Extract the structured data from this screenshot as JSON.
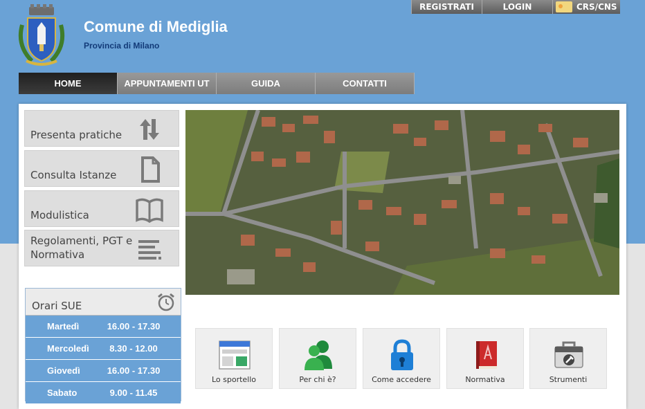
{
  "userbar": {
    "register": "REGISTRATI",
    "login": "LOGIN",
    "crs": "CRS/CNS"
  },
  "header": {
    "title": "Comune di Mediglia",
    "subtitle": "Provincia di Milano"
  },
  "nav": [
    {
      "label": "HOME",
      "active": true
    },
    {
      "label": "APPUNTAMENTI UT",
      "active": false
    },
    {
      "label": "GUIDA",
      "active": false
    },
    {
      "label": "CONTATTI",
      "active": false
    }
  ],
  "sidebar": [
    {
      "label": "Presenta pratiche",
      "icon": "sort-arrows-icon"
    },
    {
      "label": "Consulta Istanze",
      "icon": "document-icon"
    },
    {
      "label": "Modulistica",
      "icon": "open-book-icon"
    },
    {
      "label": "Regolamenti, PGT e Normativa",
      "icon": "text-lines-icon"
    }
  ],
  "hours": {
    "title": "Orari SUE",
    "rows": [
      {
        "day": "Martedì",
        "time": "16.00 - 17.30"
      },
      {
        "day": "Mercoledì",
        "time": "8.30 - 12.00"
      },
      {
        "day": "Giovedì",
        "time": "16.00 - 17.30"
      },
      {
        "day": "Sabato",
        "time": "9.00 - 11.45"
      }
    ]
  },
  "tiles": [
    {
      "label": "Lo sportello",
      "icon": "browser-window-icon"
    },
    {
      "label": "Per chi è?",
      "icon": "users-icon"
    },
    {
      "label": "Come accedere",
      "icon": "padlock-icon"
    },
    {
      "label": "Normativa",
      "icon": "red-book-icon"
    },
    {
      "label": "Strumenti",
      "icon": "toolbox-icon"
    }
  ],
  "colors": {
    "header_blue": "#6aa2d6",
    "nav_active": "#2a2a2a",
    "hours_blue": "#6aa2d6"
  }
}
